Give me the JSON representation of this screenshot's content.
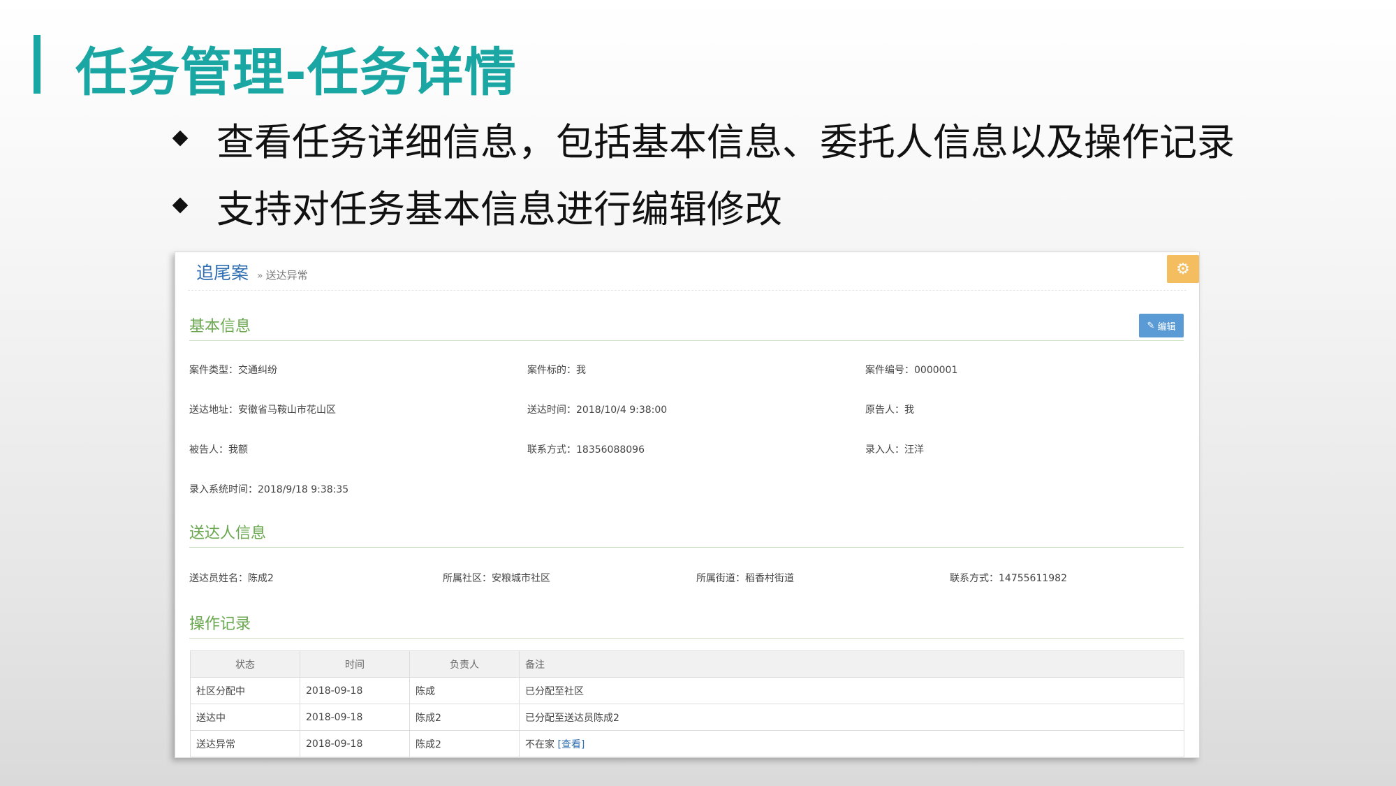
{
  "slide": {
    "title": "任务管理-任务详情",
    "bullets": [
      "查看任务详细信息，包括基本信息、委托人信息以及操作记录",
      "支持对任务基本信息进行编辑修改"
    ]
  },
  "app": {
    "breadcrumb": {
      "main": "追尾案",
      "sep": "»",
      "sub": "送达异常"
    },
    "settings_icon": "gear-icon",
    "sections": {
      "basic": "基本信息",
      "deliverer": "送达人信息",
      "ops": "操作记录"
    },
    "edit_label": "编辑",
    "basic_fields": [
      {
        "key": "案件类型",
        "value": "交通纠纷"
      },
      {
        "key": "案件标的",
        "value": "我"
      },
      {
        "key": "案件编号",
        "value": "0000001"
      },
      {
        "key": "送达地址",
        "value": "安徽省马鞍山市花山区"
      },
      {
        "key": "送达时间",
        "value": "2018/10/4 9:38:00"
      },
      {
        "key": "原告人",
        "value": "我"
      },
      {
        "key": "被告人",
        "value": "我额"
      },
      {
        "key": "联系方式",
        "value": "18356088096"
      },
      {
        "key": "录入人",
        "value": "汪洋"
      },
      {
        "key": "录入系统时间",
        "value": "2018/9/18 9:38:35"
      }
    ],
    "deliverer_fields": [
      {
        "key": "送达员姓名",
        "value": "陈成2"
      },
      {
        "key": "所属社区",
        "value": "安粮城市社区"
      },
      {
        "key": "所属街道",
        "value": "稻香村街道"
      },
      {
        "key": "联系方式",
        "value": "14755611982"
      }
    ],
    "ops_table": {
      "headers": [
        "状态",
        "时间",
        "负责人",
        "备注"
      ],
      "rows": [
        {
          "status": "社区分配中",
          "time": "2018-09-18",
          "owner": "陈成",
          "note": "已分配至社区",
          "link": ""
        },
        {
          "status": "送达中",
          "time": "2018-09-18",
          "owner": "陈成2",
          "note": "已分配至送达员陈成2",
          "link": ""
        },
        {
          "status": "送达异常",
          "time": "2018-09-18",
          "owner": "陈成2",
          "note": "不在家",
          "link": "[查看]"
        }
      ]
    }
  }
}
